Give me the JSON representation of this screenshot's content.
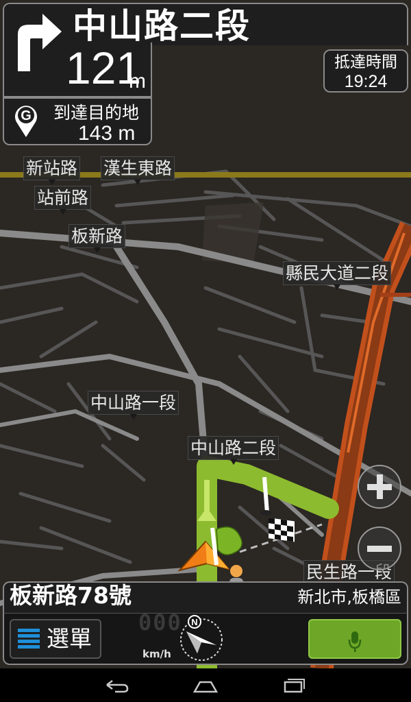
{
  "instruction": {
    "road_name": "中山路二段",
    "distance_value": "121",
    "distance_unit": "m",
    "turn_icon": "turn-right-arrow-icon"
  },
  "destination": {
    "icon": "destination-g-pin-icon",
    "label": "到達目的地",
    "distance": "143 m"
  },
  "eta": {
    "label": "抵達時間",
    "time": "19:24"
  },
  "map_labels": [
    "新站路",
    "漢生東路",
    "站前路",
    "板新路",
    "縣民大道二段",
    "中山路一段",
    "中山路二段",
    "民生路一段"
  ],
  "zoom": {
    "in_icon": "zoom-in-plus-icon",
    "out_icon": "zoom-out-minus-icon"
  },
  "address": {
    "street": "板新路78號",
    "city": "新北市,板橋區"
  },
  "bottom": {
    "menu_label": "選單",
    "speed_digits": "000",
    "speed_unit": "km/h",
    "compass_icon": "compass-north-icon",
    "mic_icon": "microphone-icon"
  },
  "colors": {
    "route": "#8dbb2f",
    "highway": "#c2501c",
    "panel_bg": "#1e1e1e",
    "menu_icon": "#1f8fd8",
    "mic_button": "#6ea627"
  },
  "android_nav": {
    "back_icon": "back-icon",
    "home_icon": "home-icon",
    "recents_icon": "recent-apps-icon"
  }
}
